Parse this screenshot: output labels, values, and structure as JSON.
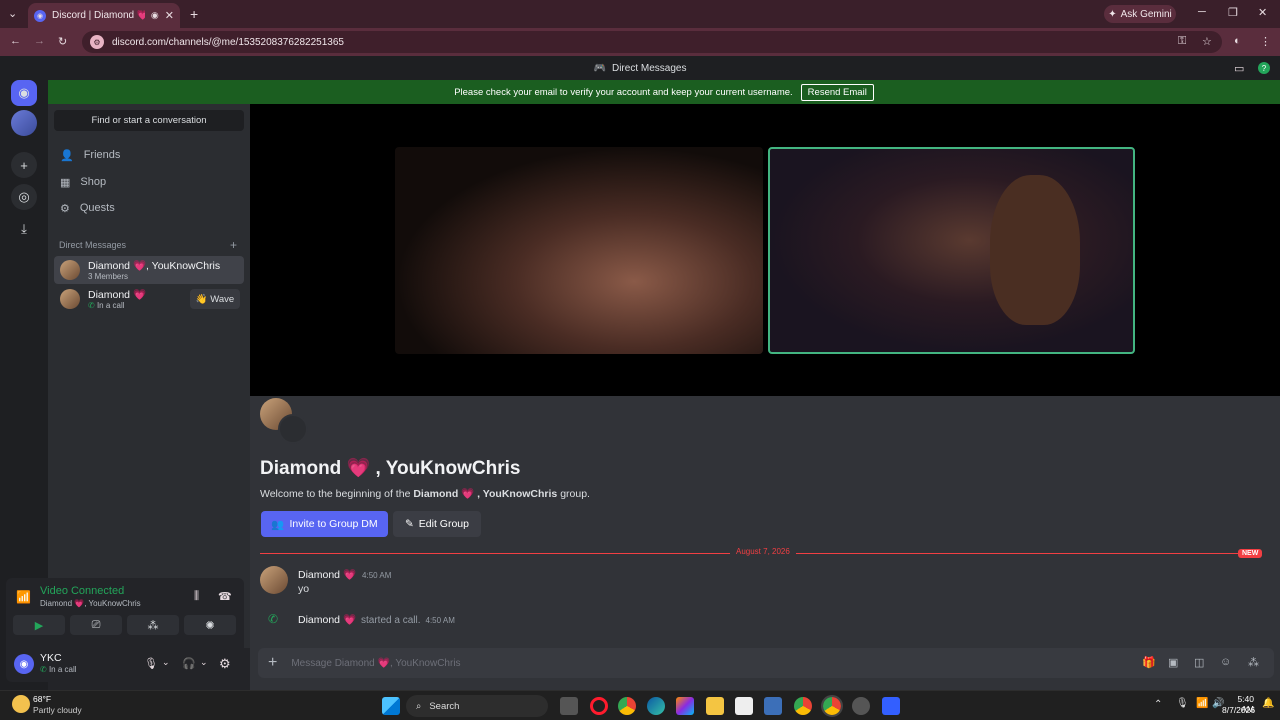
{
  "browser": {
    "tab_title": "Discord | Diamond 💗, YouKnowChris",
    "url": "discord.com/channels/@me/1535208376282251365",
    "ask_gemini": "Ask Gemini"
  },
  "titlestrip": {
    "label": "Direct Messages"
  },
  "banner": {
    "text": "Please check your email to verify your account and keep your current username.",
    "button": "Resend Email"
  },
  "sidebar": {
    "search_placeholder": "Find or start a conversation",
    "nav": [
      {
        "label": "Friends",
        "icon": "friends-icon"
      },
      {
        "label": "Shop",
        "icon": "shop-icon"
      },
      {
        "label": "Quests",
        "icon": "quests-icon"
      }
    ],
    "dm_header": "Direct Messages",
    "dms": [
      {
        "name": "Diamond 💗, YouKnowChris",
        "status": "3 Members"
      },
      {
        "name": "Diamond 💗",
        "status": "In a call",
        "action": "👋 Wave"
      }
    ]
  },
  "voice": {
    "status": "Video Connected",
    "channel": "Diamond 💗, YouKnowChris"
  },
  "user": {
    "name": "YKC",
    "status": "In a call"
  },
  "main": {
    "group_title": "Diamond 💗 , YouKnowChris",
    "welcome_prefix": "Welcome to the beginning of the ",
    "welcome_bold": "Diamond 💗 , YouKnowChris",
    "welcome_suffix": " group.",
    "invite_button": "Invite to Group DM",
    "edit_button": "Edit Group",
    "date_divider": "August 7, 2026",
    "new_badge": "NEW",
    "messages": [
      {
        "author": "Diamond 💗",
        "time": "4:50 AM",
        "text": "yo"
      }
    ],
    "system_message": {
      "author": "Diamond 💗",
      "text": "started a call.",
      "time": "4:50 AM"
    },
    "input_placeholder": "Message Diamond 💗, YouKnowChris"
  },
  "taskbar": {
    "weather_temp": "68°F",
    "weather_desc": "Partly cloudy",
    "search": "Search",
    "time": "5:40 AM",
    "date": "8/7/2026"
  },
  "colors": {
    "accent": "#5865f2",
    "connected": "#43b581",
    "banner": "#1b5e20",
    "danger": "#f23f43"
  }
}
